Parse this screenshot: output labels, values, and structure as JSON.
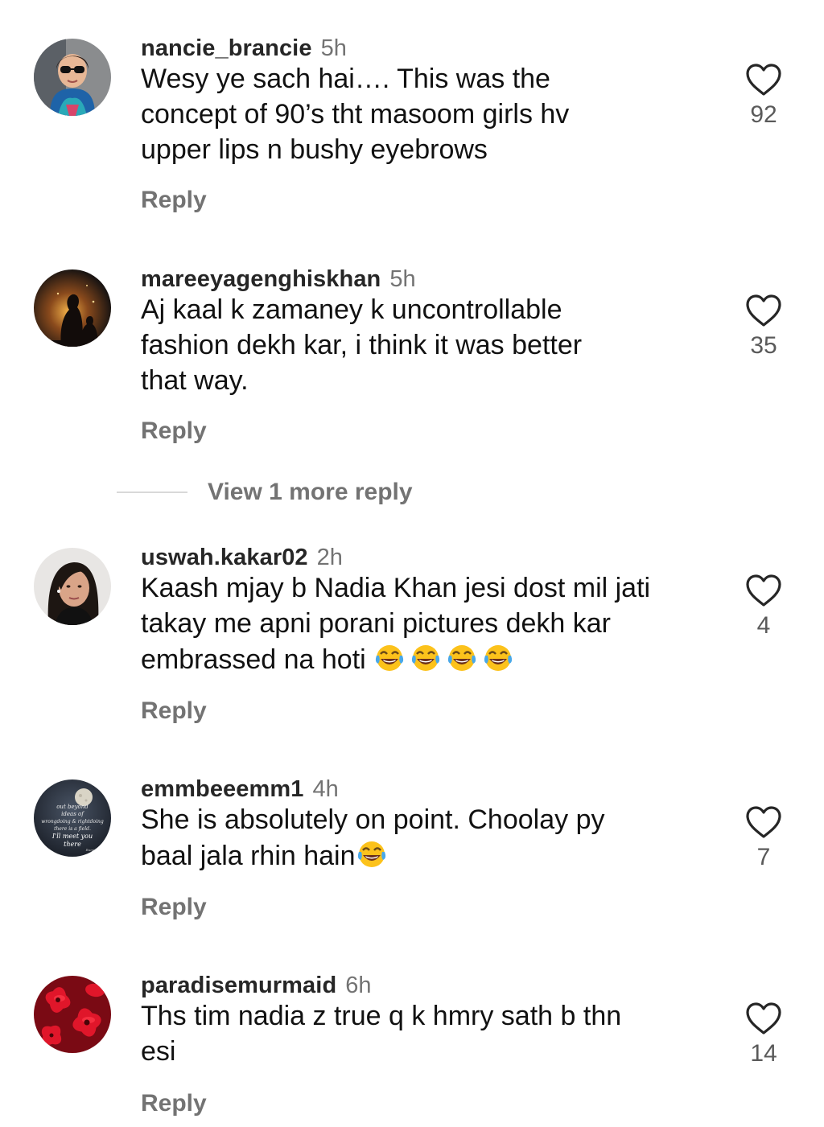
{
  "comments": [
    {
      "username": "nancie_brancie",
      "time": "5h",
      "text": "Wesy ye sach hai…. This was the\nconcept of 90’s tht masoom girls hv\nupper lips n bushy eyebrows",
      "reply_label": "Reply",
      "likes": "92",
      "avatar_icon": "woman-sunglasses-avatar"
    },
    {
      "username": "mareeyagenghiskhan",
      "time": "5h",
      "text": "Aj kaal k zamaney k uncontrollable\nfashion dekh kar, i think it was better\nthat way.",
      "reply_label": "Reply",
      "likes": "35",
      "avatar_icon": "mother-child-silhouette-avatar"
    },
    {
      "username": "uswah.kakar02",
      "time": "2h",
      "text": "Kaash mjay b Nadia Khan jesi dost mil jati\ntakay me apni porani pictures dekh kar\nembrassed na hoti ",
      "text_emoji": "😂😂😂😂",
      "reply_label": "Reply",
      "likes": "4",
      "avatar_icon": "girl-portrait-avatar"
    },
    {
      "username": "emmbeeemm1",
      "time": "4h",
      "text": "She is absolutely on point. Choolay py\nbaal jala rhin hain",
      "text_emoji": "😂",
      "reply_label": "Reply",
      "likes": "7",
      "avatar_icon": "moon-quote-avatar",
      "avatar_text": "out beyond ideas of wrongdoing & rightdoing there is a field. I'll meet you there. Rumi"
    },
    {
      "username": "paradisemurmaid",
      "time": "6h",
      "text": "Ths tim nadia z true q k hmry sath b thn\nesi",
      "reply_label": "Reply",
      "likes": "14",
      "avatar_icon": "red-flowers-avatar"
    }
  ],
  "view_more_replies": "View 1 more reply",
  "colors": {
    "username": "#262626",
    "secondary": "#737373",
    "text": "#111111",
    "heart_stroke": "#262626"
  }
}
